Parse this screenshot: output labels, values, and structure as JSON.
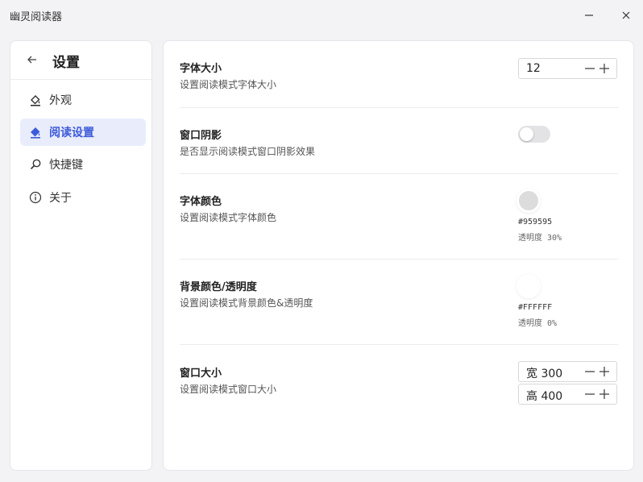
{
  "window": {
    "title": "幽灵阅读器"
  },
  "sidebar": {
    "title": "设置",
    "items": [
      {
        "label": "外观",
        "icon": "paint-bucket-icon",
        "active": false
      },
      {
        "label": "阅读设置",
        "icon": "paint-bucket-icon",
        "active": true
      },
      {
        "label": "快捷键",
        "icon": "search-icon",
        "active": false
      },
      {
        "label": "关于",
        "icon": "info-icon",
        "active": false
      }
    ]
  },
  "settings": {
    "font_size": {
      "title": "字体大小",
      "desc": "设置阅读模式字体大小",
      "value": "12"
    },
    "window_shadow": {
      "title": "窗口阴影",
      "desc": "是否显示阅读模式窗口阴影效果",
      "enabled": false
    },
    "font_color": {
      "title": "字体颜色",
      "desc": "设置阅读模式字体颜色",
      "hex": "#959595",
      "opacity": "透明度 30%",
      "swatch": "#dcdcdc"
    },
    "bg_color": {
      "title": "背景颜色/透明度",
      "desc": "设置阅读模式背景颜色&透明度",
      "hex": "#FFFFFF",
      "opacity": "透明度 0%",
      "swatch": "#ffffff"
    },
    "window_size": {
      "title": "窗口大小",
      "desc": "设置阅读模式窗口大小",
      "width": "宽 300",
      "height": "高 400"
    }
  },
  "colors": {
    "accent": "#3d5bd9",
    "active_bg": "#e9ecfb"
  }
}
